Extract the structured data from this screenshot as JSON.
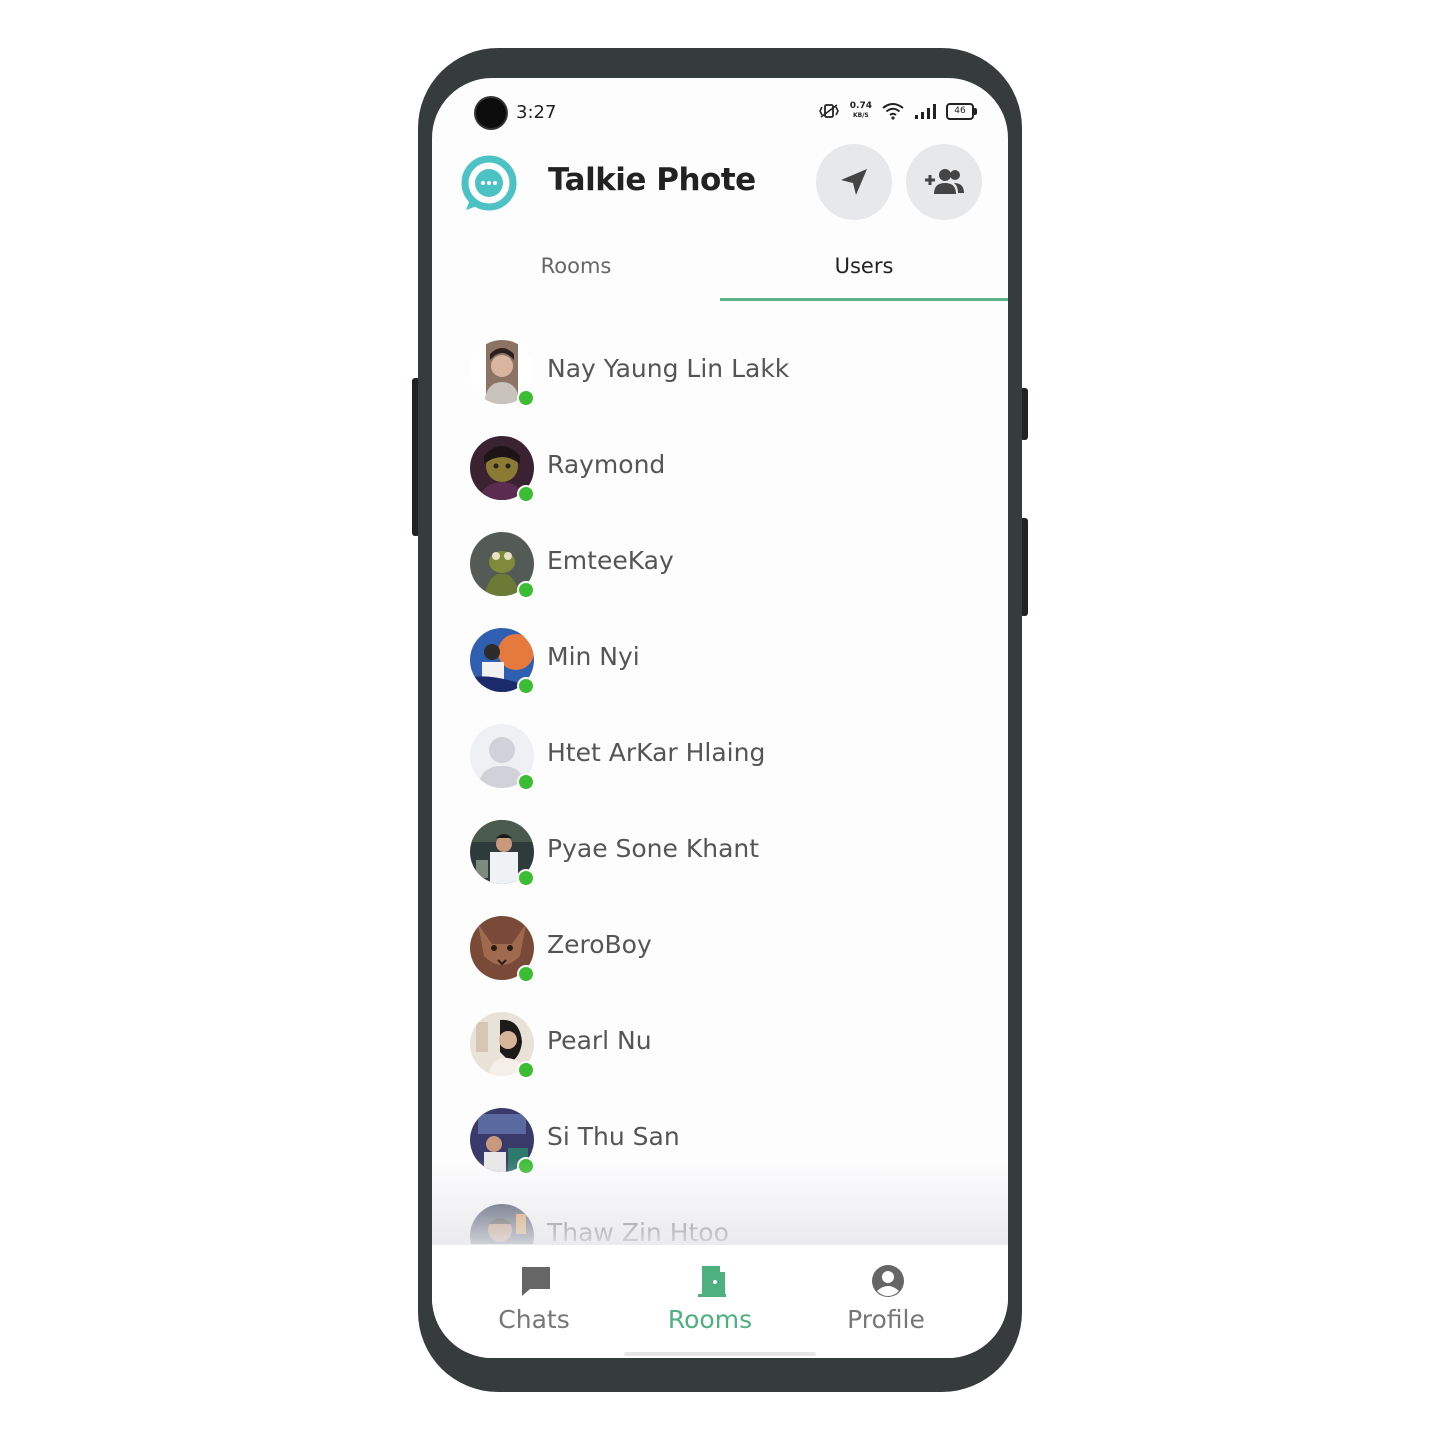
{
  "status_bar": {
    "time": "3:27",
    "net_speed_value": "0.74",
    "net_speed_unit": "KB/S",
    "battery": "46"
  },
  "header": {
    "title": "Talkie Phote",
    "logo_icon": "chat-bubble-icon",
    "send_icon": "navigation-arrow-icon",
    "add_user_icon": "add-group-icon"
  },
  "tabs": {
    "rooms": "Rooms",
    "users": "Users",
    "active": "Users"
  },
  "users": [
    {
      "name": "Nay Yaung Lin Lakk",
      "online": true
    },
    {
      "name": "Raymond",
      "online": true
    },
    {
      "name": "EmteeKay",
      "online": true
    },
    {
      "name": "Min Nyi",
      "online": true
    },
    {
      "name": "Htet ArKar Hlaing",
      "online": true
    },
    {
      "name": "Pyae Sone Khant",
      "online": true
    },
    {
      "name": "ZeroBoy",
      "online": true
    },
    {
      "name": "Pearl Nu",
      "online": true
    },
    {
      "name": "Si Thu San",
      "online": true
    },
    {
      "name": "Thaw Zin Htoo",
      "online": false
    }
  ],
  "bottom_nav": {
    "chats": "Chats",
    "rooms": "Rooms",
    "profile": "Profile",
    "active": "Rooms"
  },
  "colors": {
    "accent": "#4fb07f",
    "online": "#3bbd33",
    "logo": "#4cc2c4",
    "frame": "#353c3b"
  }
}
